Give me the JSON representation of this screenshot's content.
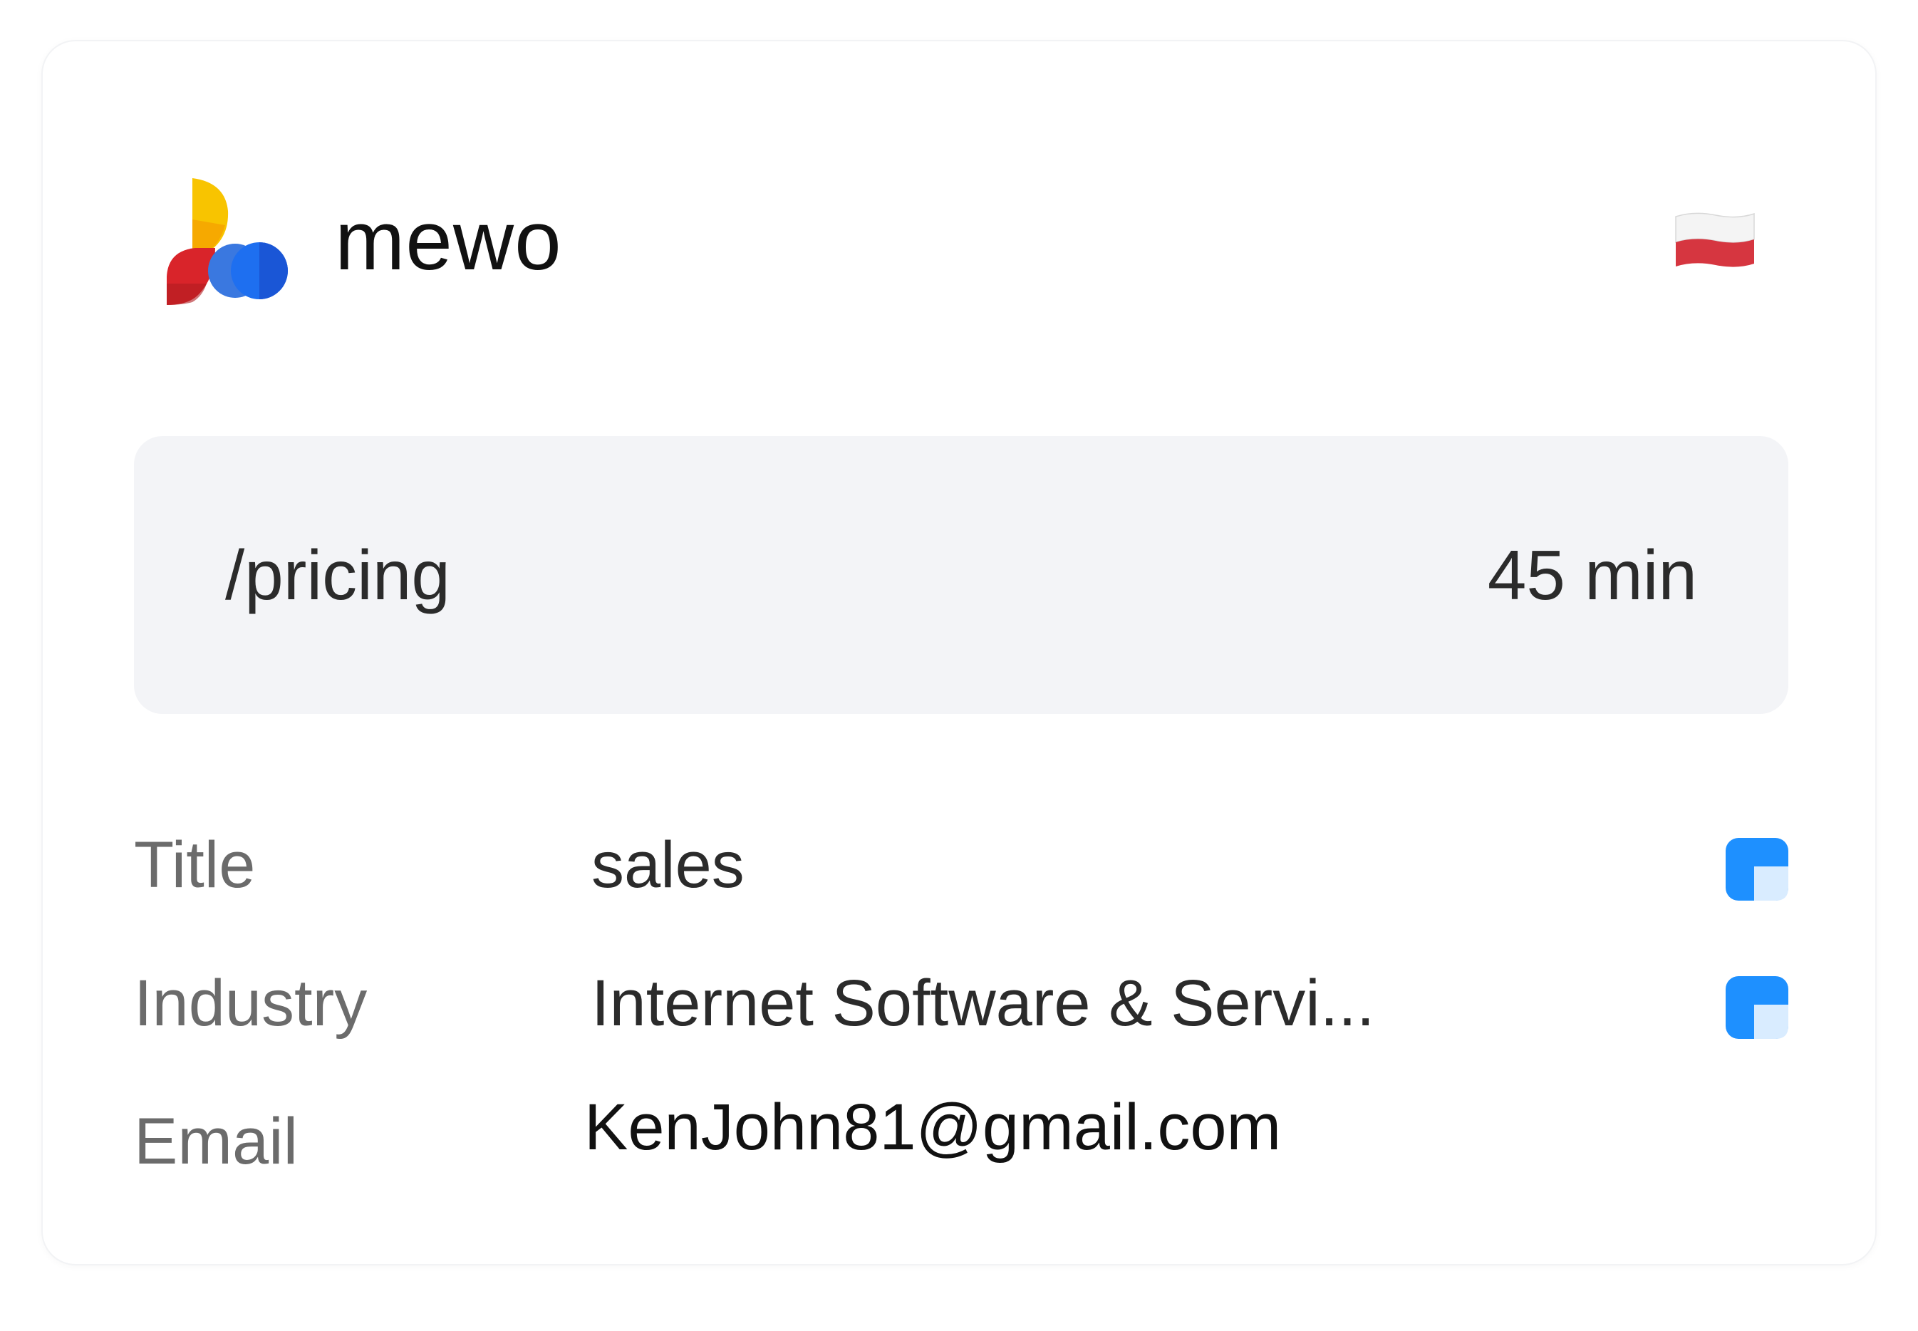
{
  "company": {
    "name": "mewo",
    "logo_icon": "mewo-logo-icon",
    "country_flag_icon": "poland-flag-icon"
  },
  "visit": {
    "path": "/pricing",
    "duration": "45 min"
  },
  "details": [
    {
      "label": "Title",
      "value": "sales",
      "copy_icon": "copy-icon"
    },
    {
      "label": "Industry",
      "value": "Internet Software & Servi...",
      "copy_icon": "copy-icon"
    },
    {
      "label": "Email",
      "value": "KenJohn81@gmail.com"
    }
  ],
  "colors": {
    "card_background": "#ffffff",
    "visit_background": "#f3f4f7",
    "label_text": "#6b6b6b",
    "value_text": "#2b2b2b",
    "accent_blue": "#1e90ff"
  }
}
